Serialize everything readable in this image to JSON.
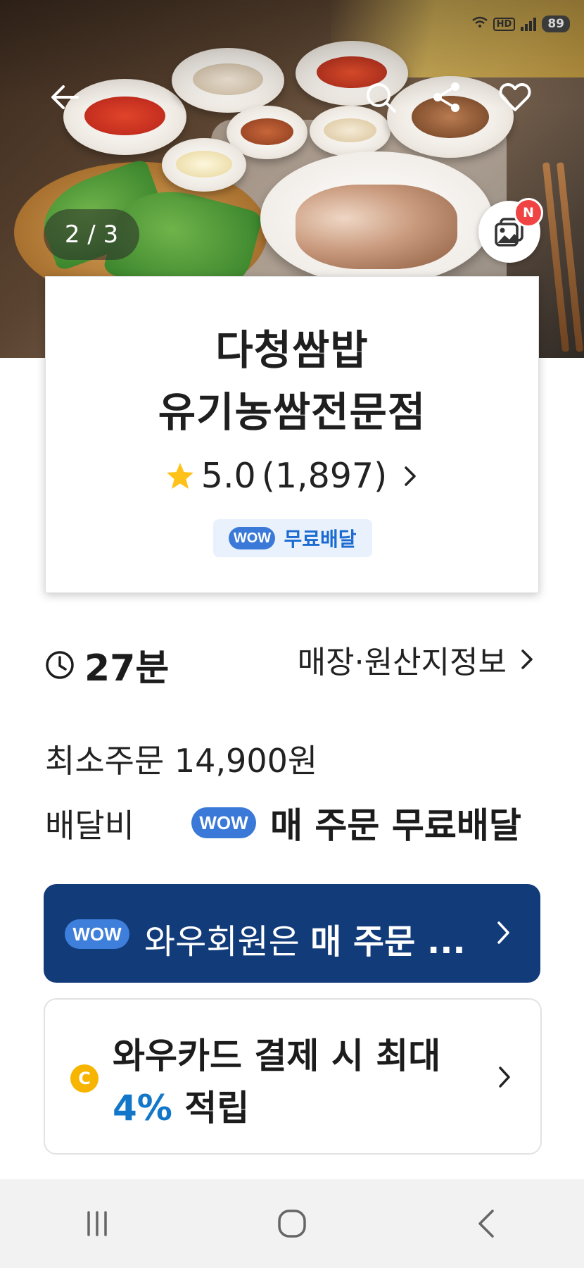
{
  "status_bar": {
    "network": "HD",
    "battery": "89"
  },
  "hero": {
    "image_counter": "2 / 3",
    "gallery_badge": "N"
  },
  "store": {
    "name_line1": "다청쌈밥",
    "name_line2": "유기농쌈전문점",
    "rating": "5.0",
    "review_count": "(1,897)",
    "wow_badge": "WOW",
    "free_delivery": "무료배달"
  },
  "info": {
    "delivery_time": "27분",
    "store_info_link": "매장·원산지정보",
    "min_order_label": "최소주문",
    "min_order_value": "14,900원",
    "delivery_fee_label": "배달비",
    "wow_badge": "WOW",
    "delivery_fee_value": "매 주문 무료배달"
  },
  "wow_banner": {
    "badge": "WOW",
    "text_normal": "와우회원은 ",
    "text_bold": "매 주문 ..."
  },
  "card_banner": {
    "coin": "C",
    "line1": "와우카드 결제 시 최대",
    "line2_pct": "4%",
    "line2_rest": " 적립"
  },
  "colors": {
    "wow_blue": "#3b79d8",
    "banner_navy": "#123b7a",
    "accent_percent": "#1277c8",
    "star": "#ffc21a",
    "badge_red": "#f04444"
  }
}
